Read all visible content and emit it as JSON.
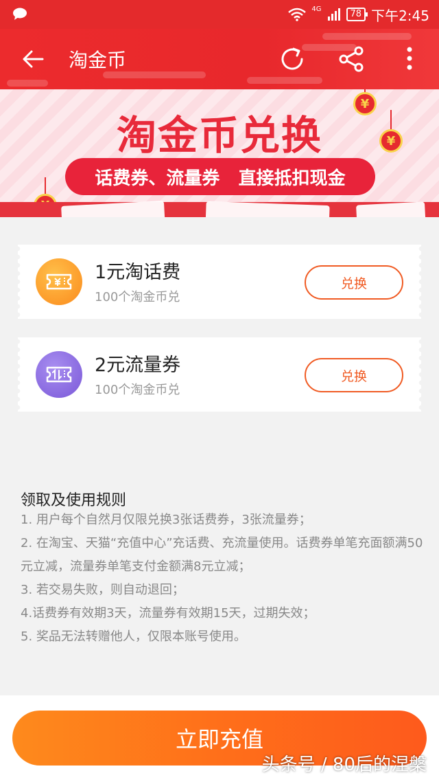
{
  "status_bar": {
    "network": "4G",
    "battery": "78",
    "time": "下午2:45"
  },
  "header": {
    "title": "淘金币"
  },
  "banner": {
    "title": "淘金币兑换",
    "subtitle": "话费券、流量券   直接抵扣现金",
    "coin_symbol": "¥"
  },
  "items": [
    {
      "name": "1元淘话费",
      "cost": "100个淘金币兑",
      "button": "兑换"
    },
    {
      "name": "2元流量券",
      "cost": "100个淘金币兑",
      "button": "兑换"
    }
  ],
  "rules": {
    "title": "领取及使用规则",
    "lines": [
      "1. 用户每个自然月仅限兑换3张话费券，3张流量券；",
      "2. 在淘宝、天猫“充值中心”充话费、充流量使用。话费券单笔充面额满50元立减，流量券单笔支付金额满8元立减；",
      "3. 若交易失败，则自动退回；",
      "4.话费券有效期3天，流量券有效期15天，过期失效；",
      "5. 奖品无法转赠他人，仅限本账号使用。"
    ]
  },
  "recharge_button": "立即充值",
  "watermark": "头条号 / 80后的涅槃"
}
